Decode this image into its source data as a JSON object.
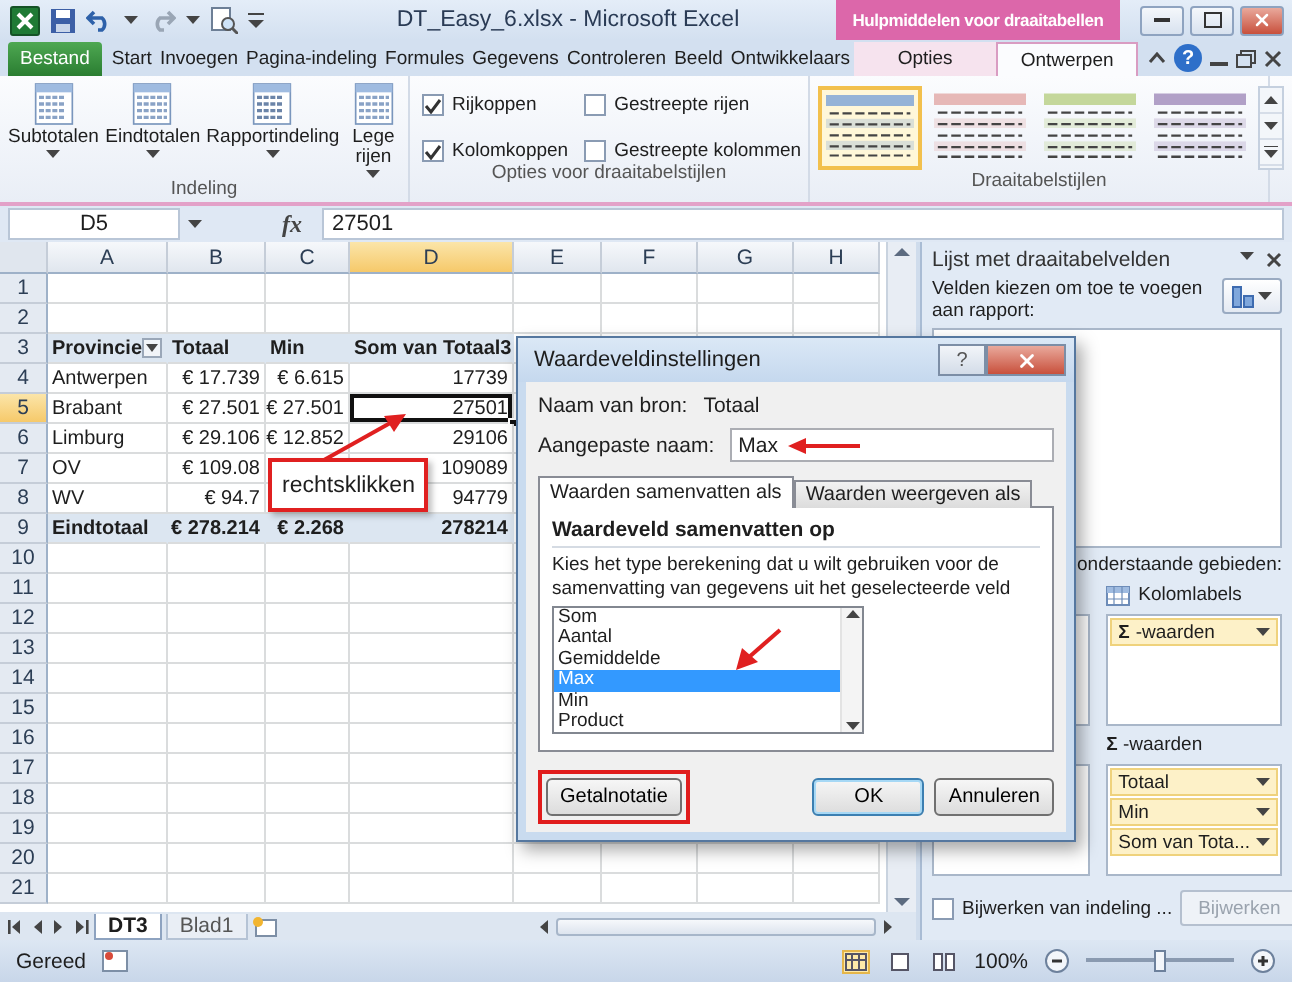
{
  "title_bar": {
    "title": "DT_Easy_6.xlsx - Microsoft Excel",
    "context_label": "Hulpmiddelen voor draaitabellen"
  },
  "ribbon_tabs": [
    {
      "label": "Bestand",
      "kind": "file",
      "selected": false
    },
    {
      "label": "Start",
      "kind": "normal",
      "selected": false
    },
    {
      "label": "Invoegen",
      "kind": "normal",
      "selected": false
    },
    {
      "label": "Pagina-indeling",
      "kind": "normal",
      "selected": false
    },
    {
      "label": "Formules",
      "kind": "normal",
      "selected": false
    },
    {
      "label": "Gegevens",
      "kind": "normal",
      "selected": false
    },
    {
      "label": "Controleren",
      "kind": "normal",
      "selected": false
    },
    {
      "label": "Beeld",
      "kind": "normal",
      "selected": false
    },
    {
      "label": "Ontwikkelaars",
      "kind": "normal",
      "selected": false
    },
    {
      "label": "Opties",
      "kind": "context",
      "selected": false
    },
    {
      "label": "Ontwerpen",
      "kind": "context",
      "selected": true
    }
  ],
  "help_glyph": "?",
  "ribbon_groups": [
    {
      "title": "Indeling",
      "kind": "buttons",
      "buttons": [
        {
          "label": "Subtotalen"
        },
        {
          "label": "Eindtotalen"
        },
        {
          "label": "Rapportindeling"
        },
        {
          "label": "Lege rijen"
        }
      ]
    },
    {
      "title": "Opties voor draaitabelstijlen",
      "kind": "checks",
      "options": [
        {
          "label": "Rijkoppen",
          "checked": true
        },
        {
          "label": "Gestreepte rijen",
          "checked": false
        },
        {
          "label": "Kolomkoppen",
          "checked": true
        },
        {
          "label": "Gestreepte kolommen",
          "checked": false
        }
      ]
    },
    {
      "title": "Draaitabelstijlen",
      "kind": "gallery",
      "styles": [
        {
          "color": "#95b3d7",
          "selected": true
        },
        {
          "color": "#e6b8b7",
          "selected": false
        },
        {
          "color": "#c4d79b",
          "selected": false
        },
        {
          "color": "#b1a0c7",
          "selected": false
        }
      ]
    }
  ],
  "formula_bar": {
    "name_box": "D5",
    "function_symbol": "fx",
    "value": "27501"
  },
  "sheet": {
    "columns": [
      {
        "label": "A",
        "selected": false
      },
      {
        "label": "B",
        "selected": false
      },
      {
        "label": "C",
        "selected": false
      },
      {
        "label": "D",
        "selected": true
      },
      {
        "label": "E",
        "selected": false
      },
      {
        "label": "F",
        "selected": false
      },
      {
        "label": "G",
        "selected": false
      },
      {
        "label": "H",
        "selected": false
      }
    ],
    "rows": [
      {
        "number": "1",
        "selected": false,
        "kind": "empty"
      },
      {
        "number": "2",
        "selected": false,
        "kind": "empty"
      },
      {
        "number": "3",
        "selected": false,
        "kind": "header",
        "cells": [
          {
            "text": "Provincie",
            "selected": false,
            "filter": true
          },
          {
            "text": "Totaal",
            "selected": false
          },
          {
            "text": "Min",
            "selected": false
          },
          {
            "text": "Som van Totaal3",
            "selected": false
          }
        ]
      },
      {
        "number": "4",
        "selected": false,
        "kind": "data",
        "cells": [
          {
            "text": "Antwerpen",
            "selected": false
          },
          {
            "text": "€ 17.739",
            "selected": false
          },
          {
            "text": "€ 6.615",
            "selected": false
          },
          {
            "text": "17739",
            "selected": false
          }
        ]
      },
      {
        "number": "5",
        "selected": true,
        "kind": "data",
        "cells": [
          {
            "text": "Brabant",
            "selected": false
          },
          {
            "text": "€ 27.501",
            "selected": false
          },
          {
            "text": "€ 27.501",
            "selected": false
          },
          {
            "text": "27501",
            "selected": true
          }
        ]
      },
      {
        "number": "6",
        "selected": false,
        "kind": "data",
        "cells": [
          {
            "text": "Limburg",
            "selected": false
          },
          {
            "text": "€ 29.106",
            "selected": false
          },
          {
            "text": "€ 12.852",
            "selected": false
          },
          {
            "text": "29106",
            "selected": false
          }
        ]
      },
      {
        "number": "7",
        "selected": false,
        "kind": "data",
        "cells": [
          {
            "text": "OV",
            "selected": false
          },
          {
            "text": "€ 109.08",
            "selected": false
          },
          {
            "selected": false
          },
          {
            "text": "109089",
            "selected": false
          }
        ]
      },
      {
        "number": "8",
        "selected": false,
        "kind": "data",
        "cells": [
          {
            "text": "WV",
            "selected": false
          },
          {
            "text": "€ 94.7",
            "selected": false
          },
          {
            "selected": false
          },
          {
            "text": "94779",
            "selected": false
          }
        ]
      },
      {
        "number": "9",
        "selected": false,
        "kind": "total",
        "cells": [
          {
            "text": "Eindtotaal",
            "selected": false
          },
          {
            "text": "€ 278.214",
            "selected": false
          },
          {
            "text": "€ 2.268",
            "selected": false
          },
          {
            "text": "278214",
            "selected": false
          }
        ]
      },
      {
        "number": "10",
        "selected": false,
        "kind": "empty"
      },
      {
        "number": "11",
        "selected": false,
        "kind": "empty"
      },
      {
        "number": "12",
        "selected": false,
        "kind": "empty"
      },
      {
        "number": "13",
        "selected": false,
        "kind": "empty"
      },
      {
        "number": "14",
        "selected": false,
        "kind": "empty"
      },
      {
        "number": "15",
        "selected": false,
        "kind": "empty"
      },
      {
        "number": "16",
        "selected": false,
        "kind": "empty"
      },
      {
        "number": "17",
        "selected": false,
        "kind": "empty"
      },
      {
        "number": "18",
        "selected": false,
        "kind": "empty"
      },
      {
        "number": "19",
        "selected": false,
        "kind": "empty"
      },
      {
        "number": "20",
        "selected": false,
        "kind": "empty"
      },
      {
        "number": "21",
        "selected": false,
        "kind": "empty"
      }
    ],
    "callout": "rechtsklikken"
  },
  "sheet_tabs": [
    {
      "label": "DT3",
      "selected": true
    },
    {
      "label": "Blad1",
      "selected": false
    }
  ],
  "dialog": {
    "title": "Waardeveldinstellingen",
    "help_glyph": "?",
    "source_label": "Naam van bron:",
    "source_value": "Totaal",
    "custom_name_label": "Aangepaste naam:",
    "custom_name_value": "Max",
    "tabs": [
      {
        "label": "Waarden samenvatten als",
        "selected": true
      },
      {
        "label": "Waarden weergeven als",
        "selected": false
      }
    ],
    "section_title": "Waardeveld samenvatten op",
    "description": "Kies het type berekening dat u wilt gebruiken voor de samenvatting van gegevens uit het geselecteerde veld",
    "functions": [
      {
        "label": "Som",
        "selected": false
      },
      {
        "label": "Aantal",
        "selected": false
      },
      {
        "label": "Gemiddelde",
        "selected": false
      },
      {
        "label": "Max",
        "selected": true
      },
      {
        "label": "Min",
        "selected": false
      },
      {
        "label": "Product",
        "selected": false
      }
    ],
    "buttons": [
      {
        "label": "Getalnotatie",
        "kind": "format",
        "highlighted": true
      },
      {
        "label": "OK",
        "kind": "ok",
        "highlighted": false
      },
      {
        "label": "Annuleren",
        "kind": "cancel",
        "highlighted": false
      }
    ]
  },
  "pivot_pane": {
    "title": "Lijst met draaitabelvelden",
    "instruction": "Velden kiezen om toe te voegen aan rapport:",
    "areas_hint": "onderstaande gebieden:",
    "areas": [
      {
        "kind": "columns",
        "title": "Kolomlabels",
        "fields": [
          {
            "symbol": "Σ",
            "label": "-waarden"
          }
        ]
      },
      {
        "kind": "values",
        "symbol": "Σ",
        "title": "-waarden",
        "fields": [
          {
            "label": "Totaal"
          },
          {
            "label": "Min"
          },
          {
            "label": "Som van Tota..."
          }
        ]
      }
    ],
    "defer_update": {
      "label": "Bijwerken van indeling ...",
      "checked": false
    },
    "update_button": {
      "label": "Bijwerken",
      "disabled": true
    }
  },
  "status_bar": {
    "status": "Gereed",
    "views": [
      {
        "kind": "normal",
        "selected": true
      },
      {
        "kind": "page_layout",
        "selected": false
      },
      {
        "kind": "page_break",
        "selected": false
      }
    ],
    "zoom": "100%",
    "zoom_slider": {
      "level": 0.5
    }
  }
}
